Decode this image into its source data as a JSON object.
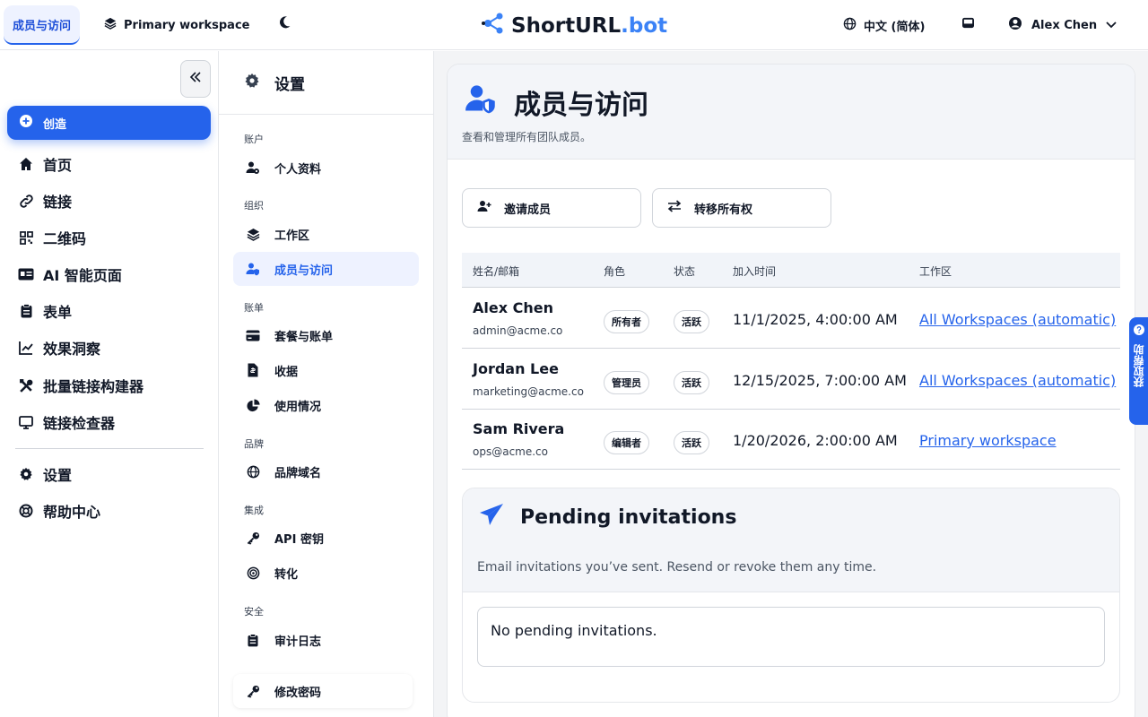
{
  "topbar": {
    "active_tab": "成员与访问",
    "workspace": "Primary workspace",
    "logo_main": "ShortURL",
    "logo_accent": ".bot",
    "language": "中文 (简体)",
    "user_name": "Alex Chen"
  },
  "sidebar": {
    "create_label": "创造",
    "items": [
      {
        "label": "首页",
        "icon": "home-icon"
      },
      {
        "label": "链接",
        "icon": "link-icon"
      },
      {
        "label": "二维码",
        "icon": "qr-icon"
      },
      {
        "label": "AI 智能页面",
        "icon": "id-card-icon"
      },
      {
        "label": "表单",
        "icon": "clipboard-icon"
      },
      {
        "label": "效果洞察",
        "icon": "chart-icon"
      },
      {
        "label": "批量链接构建器",
        "icon": "tools-icon"
      },
      {
        "label": "链接检查器",
        "icon": "monitor-icon"
      },
      {
        "label": "设置",
        "icon": "gear-icon"
      },
      {
        "label": "帮助中心",
        "icon": "lifebuoy-icon"
      }
    ]
  },
  "settings": {
    "title": "设置",
    "groups": {
      "account": "账户",
      "org": "组织",
      "billing": "账单",
      "brand": "品牌",
      "integration": "集成",
      "security": "安全"
    },
    "items": {
      "profile": "个人资料",
      "workspace": "工作区",
      "members": "成员与访问",
      "plans": "套餐与账单",
      "receipts": "收据",
      "usage": "使用情况",
      "domains": "品牌域名",
      "api_keys": "API 密钥",
      "conversions": "转化",
      "audit_log": "审计日志",
      "change_password": "修改密码"
    }
  },
  "main": {
    "title": "成员与访问",
    "subtitle": "查看和管理所有团队成员。",
    "invite_button": "邀请成员",
    "transfer_button": "转移所有权",
    "table": {
      "headers": [
        "姓名/邮箱",
        "角色",
        "状态",
        "加入时间",
        "工作区"
      ],
      "rows": [
        {
          "name": "Alex Chen",
          "email": "admin@acme.co",
          "role": "所有者",
          "status": "活跃",
          "joined": "11/1/2025, 4:00:00 AM",
          "workspace": "All Workspaces (automatic)"
        },
        {
          "name": "Jordan Lee",
          "email": "marketing@acme.co",
          "role": "管理员",
          "status": "活跃",
          "joined": "12/15/2025, 7:00:00 AM",
          "workspace": "All Workspaces (automatic)"
        },
        {
          "name": "Sam Rivera",
          "email": "ops@acme.co",
          "role": "编辑者",
          "status": "活跃",
          "joined": "1/20/2026, 2:00:00 AM",
          "workspace": "Primary workspace"
        }
      ]
    },
    "pending": {
      "title": "Pending invitations",
      "subtitle": "Email invitations you’ve sent. Resend or revoke them any time.",
      "empty": "No pending invitations."
    }
  },
  "help_tab": "获取帮助",
  "colors": {
    "accent": "#2563eb",
    "active_bg": "#eef2ff"
  }
}
